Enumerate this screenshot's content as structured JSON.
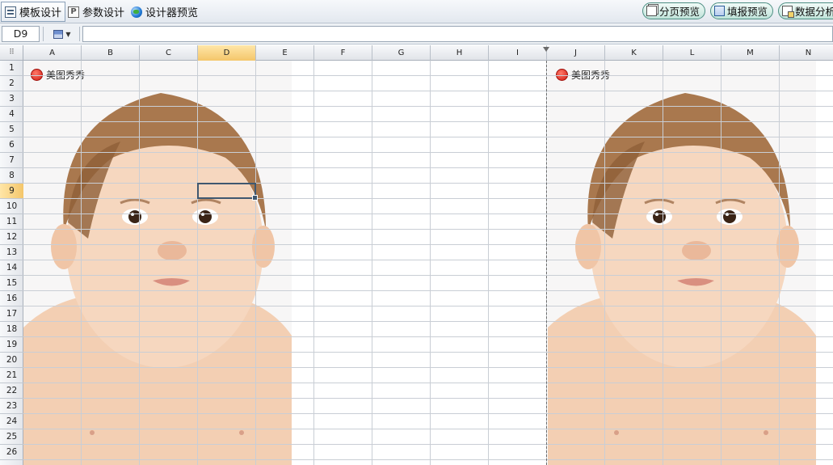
{
  "toolbar": {
    "tabs": [
      {
        "label": "模板设计",
        "icon": "template-icon",
        "active": true
      },
      {
        "label": "参数设计",
        "icon": "parameter-icon",
        "active": false
      },
      {
        "label": "设计器预览",
        "icon": "globe-icon",
        "active": false
      }
    ],
    "right_buttons": [
      {
        "label": "分页预览",
        "icon": "page-preview-icon"
      },
      {
        "label": "填报预览",
        "icon": "fill-preview-icon"
      },
      {
        "label": "数据分析",
        "icon": "data-analysis-icon"
      }
    ]
  },
  "formula_bar": {
    "cell_reference": "D9",
    "format_icon": "cell-format-icon",
    "formula": ""
  },
  "sheet": {
    "corner_glyph": "⠿",
    "columns": [
      "A",
      "B",
      "C",
      "D",
      "E",
      "F",
      "G",
      "H",
      "I",
      "J",
      "K",
      "L",
      "M",
      "N"
    ],
    "rows": [
      "1",
      "2",
      "3",
      "4",
      "5",
      "6",
      "7",
      "8",
      "9",
      "10",
      "11",
      "12",
      "13",
      "14",
      "15",
      "16",
      "17",
      "18",
      "19",
      "20",
      "21",
      "22",
      "23",
      "24",
      "25",
      "26"
    ],
    "selected_cell": {
      "column": "D",
      "row": "9"
    },
    "page_break_after_column": "I",
    "watermarks": [
      {
        "label": "美图秀秀",
        "icon": "meitu-logo-icon"
      },
      {
        "label": "美图秀秀",
        "icon": "meitu-logo-icon"
      }
    ]
  },
  "colors": {
    "selection_header": "#f4c66a",
    "selection_border": "#3f5870",
    "button_border": "#4e8f84"
  }
}
